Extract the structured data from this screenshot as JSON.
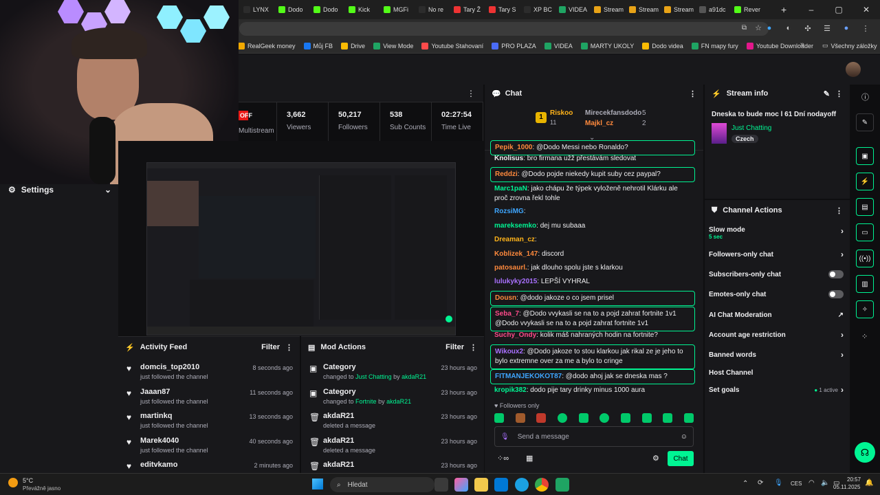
{
  "browser": {
    "tabs": [
      {
        "label": "LYNX",
        "color": "#2c2c2c"
      },
      {
        "label": "Dodo",
        "color": "#53fc18"
      },
      {
        "label": "Dodo",
        "color": "#53fc18"
      },
      {
        "label": "Kick",
        "color": "#53fc18"
      },
      {
        "label": "MGFi",
        "color": "#53fc18"
      },
      {
        "label": "No re",
        "color": "#2c2c2c"
      },
      {
        "label": "Tary Ž",
        "color": "#e33"
      },
      {
        "label": "Tary S",
        "color": "#e33"
      },
      {
        "label": "XP BC",
        "color": "#2c2c2c"
      },
      {
        "label": "VIDEA",
        "color": "#1fa463"
      },
      {
        "label": "Stream",
        "color": "#e8a317"
      },
      {
        "label": "Stream",
        "color": "#e8a317"
      },
      {
        "label": "Stream",
        "color": "#e8a317"
      },
      {
        "label": "a91dc",
        "color": "#555"
      },
      {
        "label": "Rever",
        "color": "#53fc18"
      }
    ],
    "bookmarks": [
      {
        "label": "RealGeek money",
        "color": "#f2a900"
      },
      {
        "label": "Můj FB",
        "color": "#1877f2"
      },
      {
        "label": "Drive",
        "color": "#fbbc04"
      },
      {
        "label": "View Mode",
        "color": "#1fa463"
      },
      {
        "label": "Youtube Stahovaní",
        "color": "#ff4b4b"
      },
      {
        "label": "PRO PLAZA",
        "color": "#4a6cf7"
      },
      {
        "label": "VIDEA",
        "color": "#1fa463"
      },
      {
        "label": "MARTY UKOLY",
        "color": "#1fa463"
      },
      {
        "label": "Dodo videa",
        "color": "#fbbc04"
      },
      {
        "label": "FN mapy fury",
        "color": "#1fa463"
      },
      {
        "label": "Youtube Downloader",
        "color": "#e3178b"
      }
    ],
    "bookmarks_more": "»",
    "all_bookmarks": "Všechny záložky"
  },
  "settings": {
    "label": "Settings"
  },
  "stats": {
    "multistream_badge": "OFF",
    "multistream_label": "Multistream",
    "items": [
      {
        "value": "3,662",
        "label": "Viewers"
      },
      {
        "value": "50,217",
        "label": "Followers"
      },
      {
        "value": "538",
        "label": "Sub Counts"
      },
      {
        "value": "02:27:54",
        "label": "Time Live"
      }
    ]
  },
  "activity_feed": {
    "title": "Activity Feed",
    "filter": "Filter",
    "items": [
      {
        "user": "domcis_top2010",
        "action": "just followed the channel",
        "time": "8 seconds ago"
      },
      {
        "user": "Jaaan87",
        "action": "just followed the channel",
        "time": "11 seconds ago"
      },
      {
        "user": "martinkq",
        "action": "just followed the channel",
        "time": "13 seconds ago"
      },
      {
        "user": "Marek4040",
        "action": "just followed the channel",
        "time": "40 seconds ago"
      },
      {
        "user": "editvkamo",
        "action": "",
        "time": "2 minutes ago"
      }
    ]
  },
  "mod_actions": {
    "title": "Mod Actions",
    "filter": "Filter",
    "items": [
      {
        "title": "Category",
        "prefix": "changed to ",
        "target": "Just Chatting",
        "by": " by ",
        "mod": "akdaR21",
        "time": "23 hours ago",
        "icon": "category"
      },
      {
        "title": "Category",
        "prefix": "changed to ",
        "target": "Fortnite",
        "by": " by ",
        "mod": "akdaR21",
        "time": "23 hours ago",
        "icon": "category"
      },
      {
        "title": "akdaR21",
        "prefix": "deleted a message",
        "target": "",
        "by": "",
        "mod": "",
        "time": "23 hours ago",
        "icon": "trash"
      },
      {
        "title": "akdaR21",
        "prefix": "deleted a message",
        "target": "",
        "by": "",
        "mod": "",
        "time": "23 hours ago",
        "icon": "trash"
      },
      {
        "title": "akdaR21",
        "prefix": "",
        "target": "",
        "by": "",
        "mod": "",
        "time": "23 hours ago",
        "icon": "trash"
      }
    ]
  },
  "chat": {
    "title": "Chat",
    "leader_rank": "1",
    "leader_name": "Riskoo",
    "leader_count": "11",
    "second_name": "Mirecekfansdodo",
    "second_count": "5",
    "third_name": "Majkl_cz",
    "third_count": "2",
    "messages": [
      {
        "user": "Pepik_1000",
        "color": "#ff8a3d",
        "text": "@Dodo Messi nebo Ronaldo?",
        "hl": true
      },
      {
        "user": "Knolisus",
        "color": "#efeff1",
        "text": "bro firmana užž přestávám sledovat",
        "hl": false
      },
      {
        "user": "Reddzi",
        "color": "#ff8a3d",
        "text": "@Dodo pojde niekedy kupit suby cez paypal?",
        "hl": true
      },
      {
        "user": "Marc1paN",
        "color": "#00f593",
        "text": "jako chápu že týpek vyloženě nehrotil Klárku ale proč zrovna řekl tohle",
        "hl": false
      },
      {
        "user": "RozsiMG",
        "color": "#3ea6ff",
        "text": "",
        "hl": false
      },
      {
        "user": "mareksemko",
        "color": "#00f593",
        "text": "dej mu subaaa",
        "hl": false
      },
      {
        "user": "Dreaman_cz",
        "color": "#ffb31a",
        "text": "",
        "hl": false
      },
      {
        "user": "Koblizek_147",
        "color": "#ff8a3d",
        "text": "discord",
        "hl": false
      },
      {
        "user": "patosaurl.",
        "color": "#ff8a3d",
        "text": "jak dlouho spolu jste s klarkou",
        "hl": false
      },
      {
        "user": "lulukyky2015",
        "color": "#a970ff",
        "text": "LEPŠÍ VYHRAL",
        "hl": false
      },
      {
        "user": "Dousn",
        "color": "#ff8a3d",
        "text": "@dodo jakoze o co jsem prisel",
        "hl": true
      },
      {
        "user": "Seba_7",
        "color": "#ff4b8a",
        "text": "@Dodo vvykasli se na to a pojd zahrat fortnite 1v1 @Dodo vvykasli se na to a pojd zahrat fortnite 1v1",
        "hl": true
      },
      {
        "user": "Suchy_Ondy",
        "color": "#ff4b8a",
        "text": "kolik máš nahraných hodin na fortnite?",
        "hl": false
      },
      {
        "user": "Wikoux2",
        "color": "#a970ff",
        "text": "@Dodo jakoze to stou klarkou jak rikal ze je jeho to bylo extremne over za me a bylo to cringe",
        "hl": true
      },
      {
        "user": "FITMANJEKOKOT87",
        "color": "#3ea6ff",
        "text": "@dodo ahoj jak se dneska mas ?",
        "hl": true
      },
      {
        "user": "kropik382",
        "color": "#00f593",
        "text": "dodo pije tary drinky minus 1000 aura",
        "hl": false
      }
    ],
    "followers_only": "Followers only",
    "placeholder": "Send a message",
    "send_label": "Chat"
  },
  "stream_info": {
    "title": "Stream info",
    "stream_title": "Dneska to bude moc l 61 Dní nodayoff",
    "category": "Just Chatting",
    "language": "Czech"
  },
  "channel_actions": {
    "title": "Channel Actions",
    "slow_mode": "Slow mode",
    "slow_value": "5 sec",
    "followers_only": "Followers-only chat",
    "subscribers_only": "Subscribers-only chat",
    "emotes_only": "Emotes-only chat",
    "ai_moderation": "AI Chat Moderation",
    "account_age": "Account age restriction",
    "banned_words": "Banned words",
    "host_channel": "Host Channel",
    "set_goals": "Set goals",
    "goals_active": "1 active"
  },
  "taskbar": {
    "temp": "5°C",
    "weather": "Převážně jasno",
    "search": "Hledat",
    "lang": "CES",
    "time": "20:57",
    "date": "05.11.2025"
  }
}
